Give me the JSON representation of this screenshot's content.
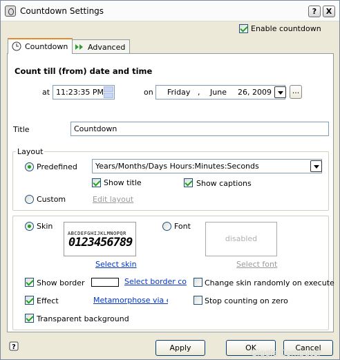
{
  "window": {
    "title": "Countdown Settings"
  },
  "enable_countdown": {
    "label": "Enable countdown",
    "checked": true
  },
  "tabs": [
    {
      "label": "Countdown",
      "icon": "clock-icon",
      "active": true
    },
    {
      "label": "Advanced",
      "icon": "double-arrow-icon",
      "active": false
    }
  ],
  "countdown": {
    "heading": "Count till (from) date and time",
    "at_label": "at",
    "time_value": "11:23:35 PM",
    "on_label": "on",
    "date": {
      "weekday": "Friday",
      "sep": ",",
      "month": "June",
      "day_year": "26, 2009"
    },
    "browse_label": "...",
    "title_label": "Title",
    "title_value": "Countdown"
  },
  "layout": {
    "group_label": "Layout",
    "predefined_label": "Predefined",
    "predefined_value": "Years/Months/Days Hours:Minutes:Seconds",
    "show_title_label": "Show title",
    "show_captions_label": "Show captions",
    "custom_label": "Custom",
    "edit_layout_label": "Edit layout"
  },
  "skin": {
    "skin_label": "Skin",
    "font_label": "Font",
    "preview_alpha": "ABCDEFGHIJKLMNOPQR",
    "preview_digits": "0123456789",
    "font_preview_text": "disabled",
    "select_skin": "Select skin",
    "select_font": "Select font",
    "show_border_label": "Show border",
    "select_border_color": "Select border color",
    "change_skin_label": "Change skin randomly on execute",
    "effect_label": "Effect",
    "effect_link": "Metamorphose via emp",
    "stop_counting_label": "Stop counting on zero",
    "transparent_label": "Transparent background"
  },
  "buttons": {
    "apply": "Apply",
    "ok": "OK",
    "cancel": "Cancel"
  },
  "watermark": "Giggle Computer",
  "titlebar": {
    "help": "?",
    "close": "X"
  }
}
